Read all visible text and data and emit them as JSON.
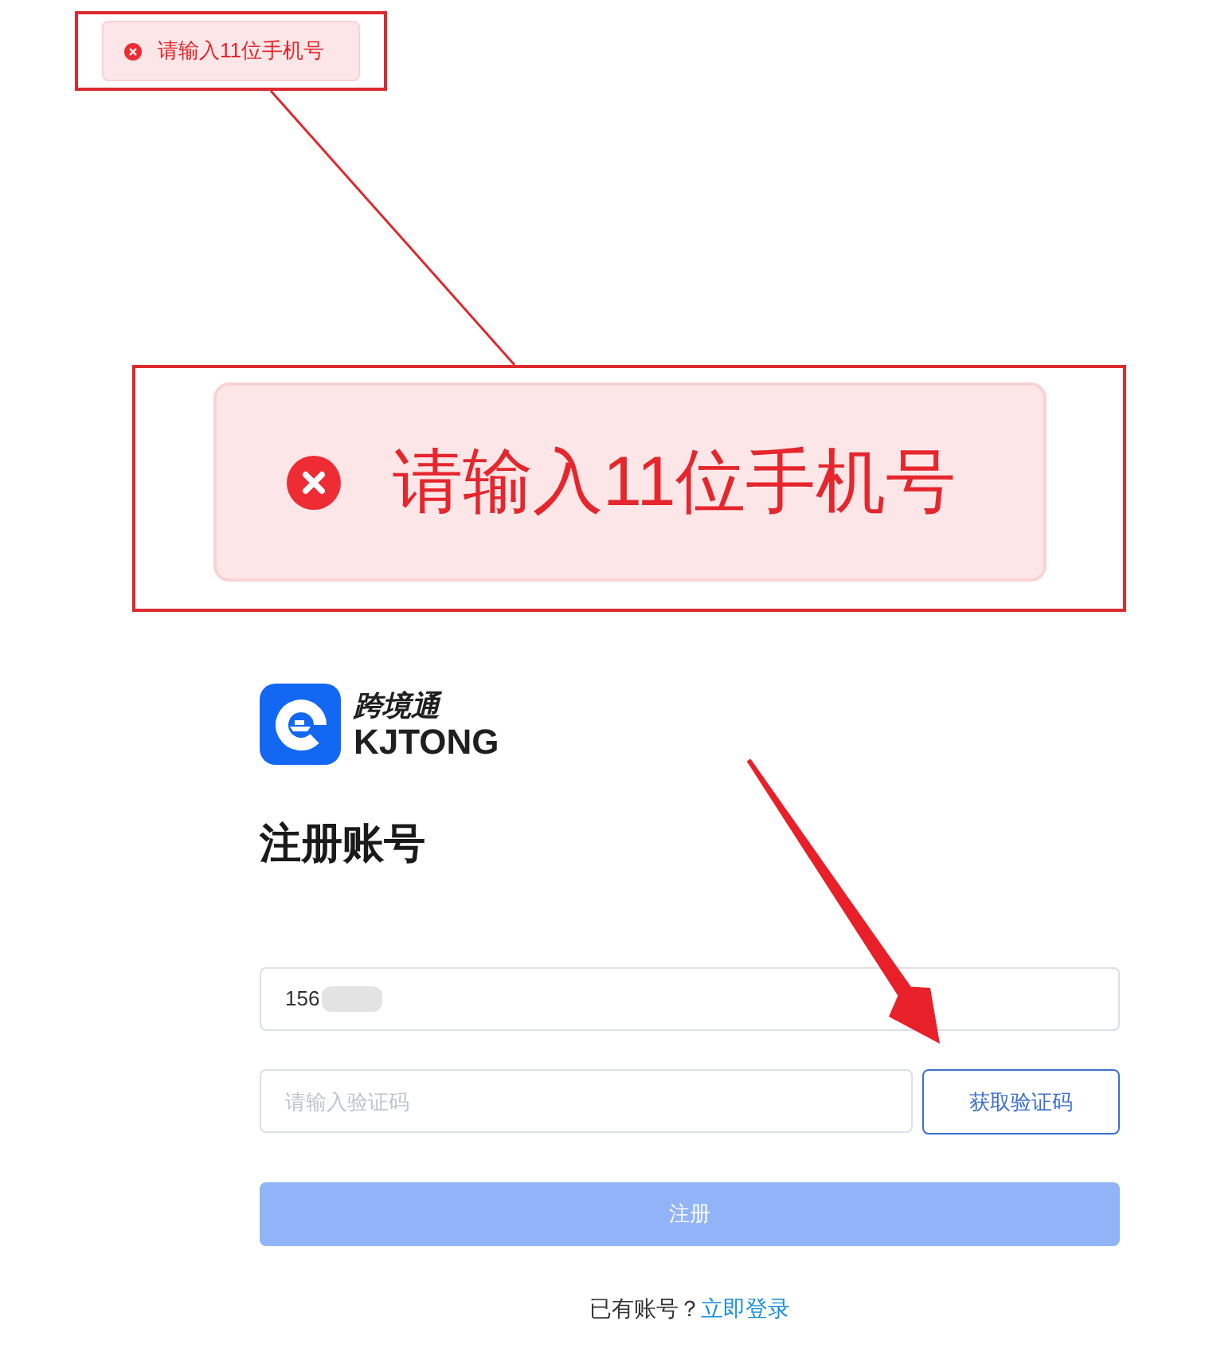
{
  "toast": {
    "kind": "error",
    "message": "请输入11位手机号"
  },
  "toast_magnified": {
    "kind": "error",
    "message": "请输入11位手机号"
  },
  "logo": {
    "name_cn": "跨境通",
    "name_en": "KJTONG"
  },
  "title": "注册账号",
  "phone_field": {
    "value": "156",
    "redacted": true
  },
  "code_field": {
    "placeholder": "请输入验证码"
  },
  "get_code_button": {
    "label": "获取验证码"
  },
  "submit_button": {
    "label": "注册",
    "disabled": true
  },
  "footer": {
    "prompt": "已有账号？",
    "link": "立即登录"
  }
}
